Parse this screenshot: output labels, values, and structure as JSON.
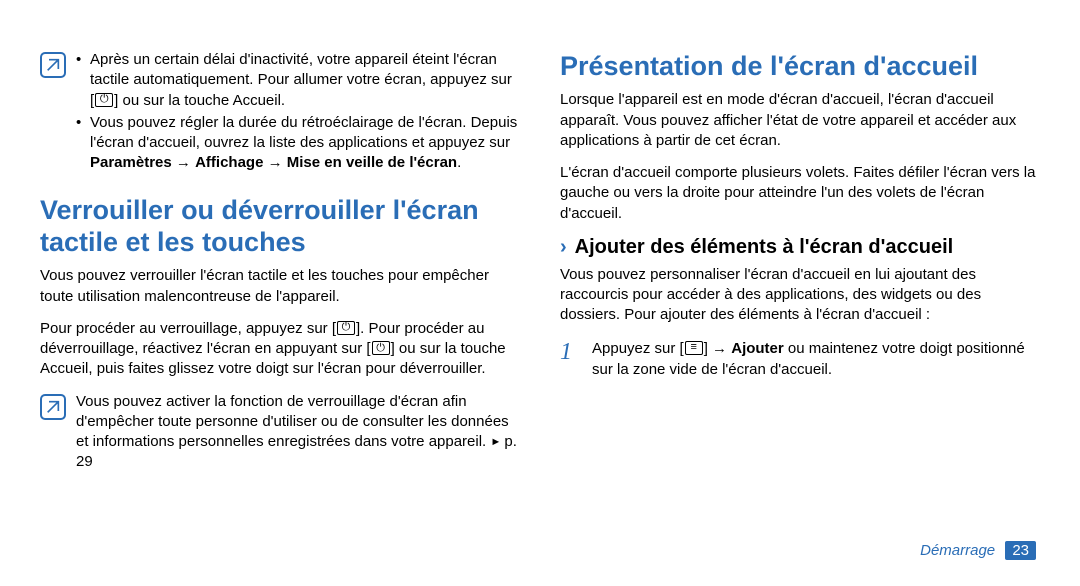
{
  "left": {
    "note1": {
      "li1_a": "Après un certain délai d'inactivité, votre appareil éteint l'écran tactile automatiquement. Pour allumer votre écran, appuyez sur [",
      "li1_b": "] ou sur la touche Accueil.",
      "li2_a": "Vous pouvez régler la durée du rétroéclairage de l'écran. Depuis l'écran d'accueil, ouvrez la liste des applications et appuyez sur ",
      "li2_b": "Paramètres",
      "li2_c": " → ",
      "li2_d": "Affichage",
      "li2_e": " → ",
      "li2_f": "Mise en veille de l'écran",
      "li2_g": "."
    },
    "heading": "Verrouiller ou déverrouiller l'écran tactile et les touches",
    "p1": "Vous pouvez verrouiller l'écran tactile et les touches pour empêcher toute utilisation malencontreuse de l'appareil.",
    "p2_a": "Pour procéder au verrouillage, appuyez sur [",
    "p2_b": "]. Pour procéder au déverrouillage, réactivez l'écran en appuyant sur [",
    "p2_c": "] ou sur la touche Accueil, puis faites glissez votre doigt sur l'écran pour déverrouiller.",
    "note2_a": "Vous pouvez activer la fonction de verrouillage d'écran afin d'empêcher toute personne d'utiliser ou de consulter les données et informations personnelles enregistrées dans votre appareil. ",
    "note2_b": "► ",
    "note2_c": "p. 29"
  },
  "right": {
    "heading": "Présentation de l'écran d'accueil",
    "p1": "Lorsque l'appareil est en mode d'écran d'accueil, l'écran d'accueil apparaît. Vous pouvez afficher l'état de votre appareil et accéder aux applications à partir de cet écran.",
    "p2": "L'écran d'accueil comporte plusieurs volets. Faites défiler l'écran vers la gauche ou vers la droite pour atteindre l'un des volets de l'écran d'accueil.",
    "sub_chev": "›",
    "sub": "Ajouter des éléments à l'écran d'accueil",
    "p3": "Vous pouvez personnaliser l'écran d'accueil en lui ajoutant des raccourcis pour accéder à des applications, des widgets ou des dossiers. Pour ajouter des éléments à l'écran d'accueil :",
    "step1_num": "1",
    "step1_a": "Appuyez sur [",
    "step1_b": "] → ",
    "step1_c": "Ajouter",
    "step1_d": " ou maintenez votre doigt positionné sur la zone vide de l'écran d'accueil."
  },
  "footer": {
    "section": "Démarrage",
    "page": "23"
  }
}
